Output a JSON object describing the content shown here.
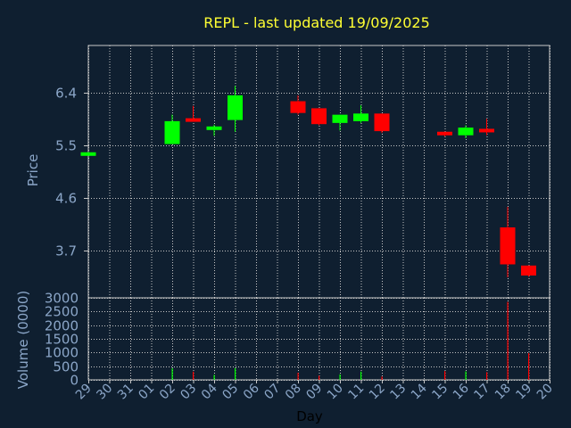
{
  "chart_data": {
    "type": "candlestick",
    "title": "REPL - last updated 19/09/2025",
    "xlabel": "Day",
    "price_panel": {
      "ylabel": "Price",
      "ylim": [
        2.9,
        7.2
      ],
      "yticks": [
        "3.7",
        "4.6",
        "5.5",
        "6.4"
      ],
      "grid": true
    },
    "volume_panel": {
      "ylabel": "Volume (0000)",
      "ylim": [
        0,
        3000
      ],
      "yticks": [
        "0",
        "500",
        "1000",
        "1500",
        "2000",
        "2500",
        "3000"
      ],
      "grid": true
    },
    "days": [
      "29",
      "30",
      "31",
      "01",
      "02",
      "03",
      "04",
      "05",
      "06",
      "07",
      "08",
      "09",
      "10",
      "11",
      "12",
      "13",
      "14",
      "15",
      "16",
      "17",
      "18",
      "19",
      "20"
    ],
    "candles": [
      {
        "day": "29",
        "open": 5.33,
        "high": 5.38,
        "low": 5.33,
        "close": 5.38
      },
      {
        "day": "02",
        "open": 5.52,
        "high": 6.02,
        "low": 5.52,
        "close": 5.91
      },
      {
        "day": "03",
        "open": 5.96,
        "high": 6.17,
        "low": 5.91,
        "close": 5.91
      },
      {
        "day": "04",
        "open": 5.77,
        "high": 5.85,
        "low": 5.66,
        "close": 5.82
      },
      {
        "day": "05",
        "open": 5.93,
        "high": 6.51,
        "low": 5.73,
        "close": 6.35
      },
      {
        "day": "08",
        "open": 6.25,
        "high": 6.35,
        "low": 6.02,
        "close": 6.05
      },
      {
        "day": "09",
        "open": 6.13,
        "high": 6.13,
        "low": 5.84,
        "close": 5.86
      },
      {
        "day": "10",
        "open": 5.88,
        "high": 6.02,
        "low": 5.75,
        "close": 6.02
      },
      {
        "day": "11",
        "open": 5.91,
        "high": 6.18,
        "low": 5.88,
        "close": 6.04
      },
      {
        "day": "12",
        "open": 6.04,
        "high": 6.04,
        "low": 5.71,
        "close": 5.74
      },
      {
        "day": "15",
        "open": 5.73,
        "high": 5.73,
        "low": 5.65,
        "close": 5.68
      },
      {
        "day": "16",
        "open": 5.67,
        "high": 5.84,
        "low": 5.62,
        "close": 5.8
      },
      {
        "day": "17",
        "open": 5.78,
        "high": 5.95,
        "low": 5.67,
        "close": 5.73
      },
      {
        "day": "18",
        "open": 4.1,
        "high": 4.45,
        "low": 3.25,
        "close": 3.47
      },
      {
        "day": "19",
        "open": 3.45,
        "high": 3.45,
        "low": 3.26,
        "close": 3.28
      }
    ],
    "volumes": [
      {
        "day": "02",
        "value": 420
      },
      {
        "day": "03",
        "value": 300
      },
      {
        "day": "04",
        "value": 180
      },
      {
        "day": "05",
        "value": 430
      },
      {
        "day": "08",
        "value": 260
      },
      {
        "day": "09",
        "value": 150
      },
      {
        "day": "10",
        "value": 200
      },
      {
        "day": "11",
        "value": 300
      },
      {
        "day": "12",
        "value": 120
      },
      {
        "day": "15",
        "value": 320
      },
      {
        "day": "16",
        "value": 310
      },
      {
        "day": "17",
        "value": 280
      },
      {
        "day": "18",
        "value": 2850
      },
      {
        "day": "19",
        "value": 980
      }
    ],
    "colors": {
      "up": "#00ff00",
      "down": "#ff0000",
      "background": "#0f1f30",
      "grid": "#c8c8c8",
      "axis_text": "#8ba6c8",
      "title": "#ffff33"
    }
  }
}
